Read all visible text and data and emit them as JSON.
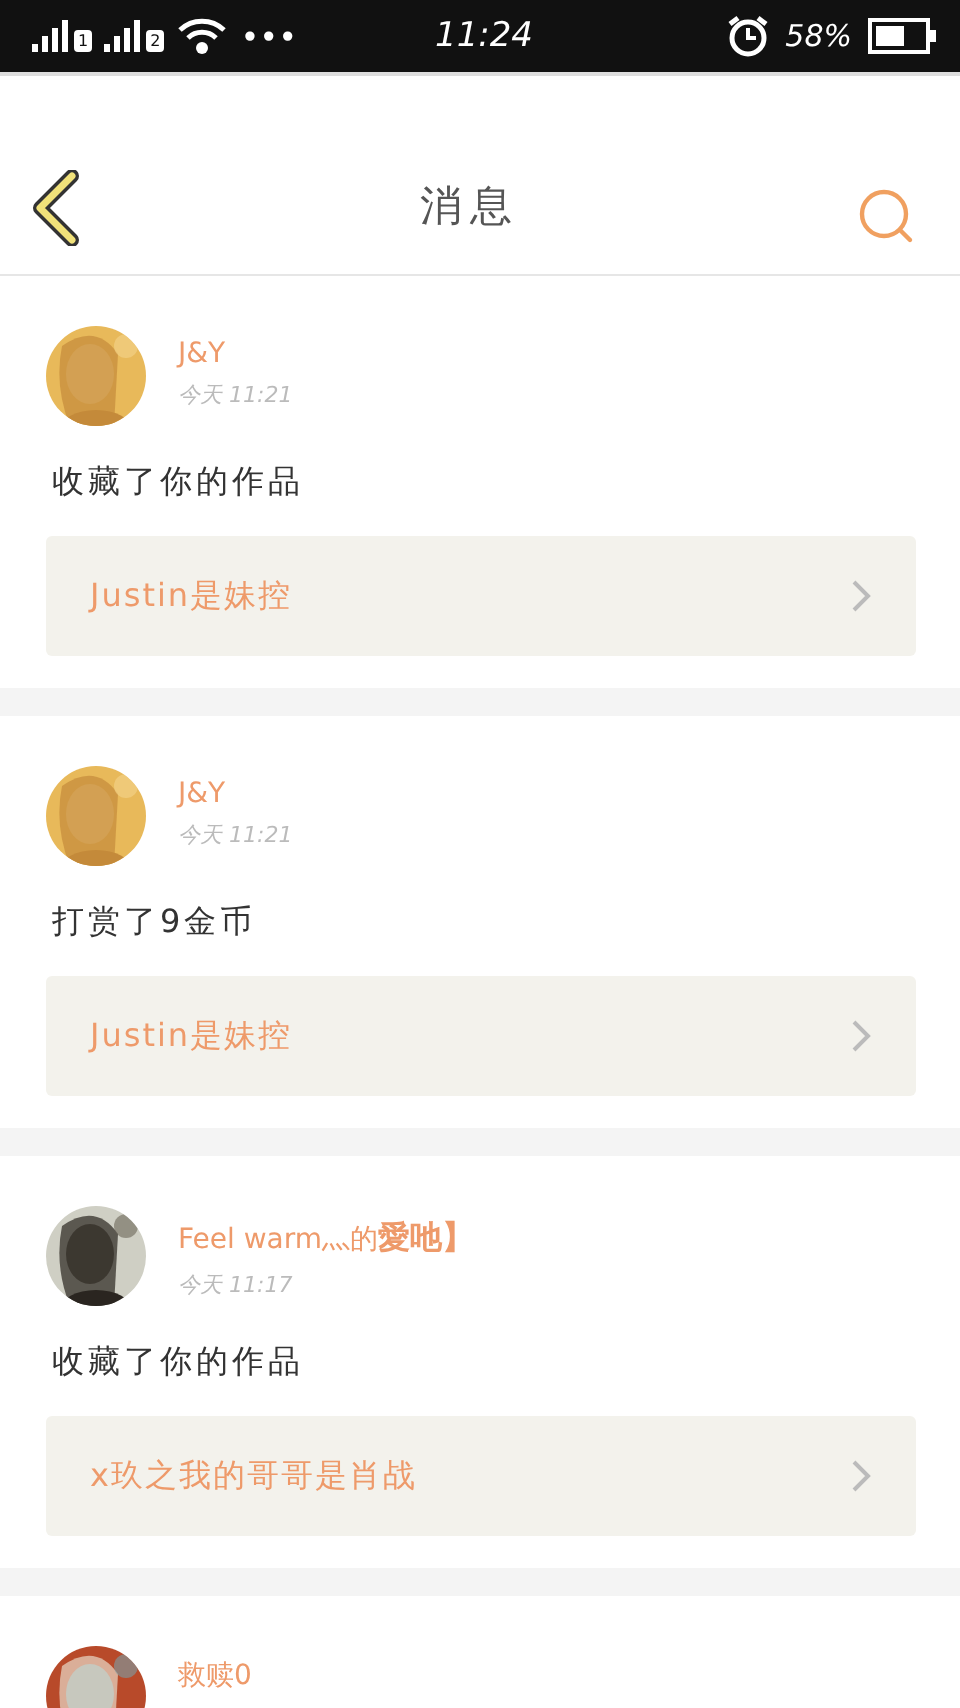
{
  "status_bar": {
    "sim_labels": [
      "1",
      "2"
    ],
    "more": "•••",
    "time": "11:24",
    "battery": "58%"
  },
  "header": {
    "title": "消息"
  },
  "messages": [
    {
      "user": "J&Y",
      "time": "今天 11:21",
      "action": "收藏了你的作品",
      "work": "Justin是妹控"
    },
    {
      "user": "J&Y",
      "time": "今天 11:21",
      "action": "打赏了9金币",
      "work": "Justin是妹控"
    },
    {
      "user": "Feel warm灬的**愛吔】**",
      "time": "今天 11:17",
      "action": "收藏了你的作品",
      "work": "x玖之我的哥哥是肖战"
    },
    {
      "user": "救赎0"
    }
  ]
}
